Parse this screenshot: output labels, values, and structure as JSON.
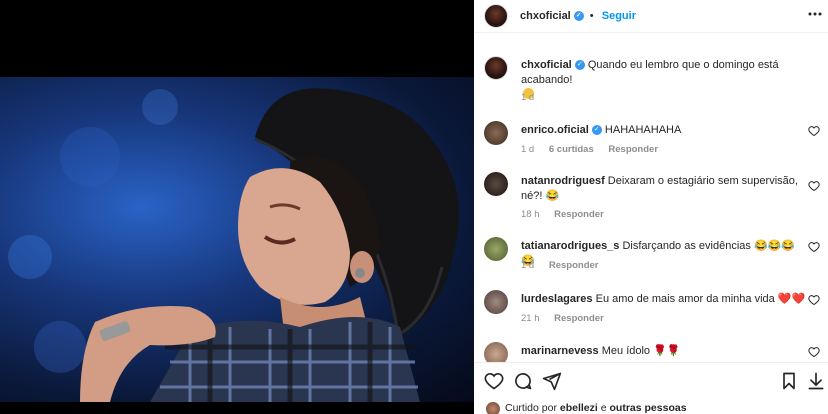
{
  "post": {
    "username": "chxoficial",
    "dot": "•",
    "follow_label": "Seguir",
    "more_label": "•••",
    "caption": "Quando eu lembro que o domingo está acabando!",
    "caption_age": "1 d"
  },
  "comments": [
    {
      "username": "enrico.oficial",
      "verified": true,
      "text": "HAHAHAHAHA",
      "age": "1 d",
      "likes": "6 curtidas",
      "reply": "Responder"
    },
    {
      "username": "natanrodriguesf",
      "verified": false,
      "text": "Deixaram o estagiário sem supervisão, né?! 😂",
      "age": "18 h",
      "likes": "",
      "reply": "Responder"
    },
    {
      "username": "tatianarodrigues_s",
      "verified": false,
      "text": "Disfarçando as evidências 😂😂😂😂",
      "age": "1 d",
      "likes": "",
      "reply": "Responder"
    },
    {
      "username": "lurdeslagares",
      "verified": false,
      "text": "Eu amo de mais amor da minha vida ❤️❤️",
      "age": "21 h",
      "likes": "",
      "reply": "Responder"
    },
    {
      "username": "marinarnevess",
      "verified": false,
      "text": "Meu ídolo 🌹🌹",
      "age": "",
      "likes": "",
      "reply": ""
    }
  ],
  "liked_by": {
    "prefix": "Curtido por",
    "user": "ebellezi",
    "connector": "e",
    "others": "outras pessoas"
  },
  "colors": {
    "accent": "#0095f6",
    "verified": "#3897f0"
  },
  "icons": [
    "heart-icon",
    "comment-icon",
    "share-icon",
    "bookmark-icon",
    "download-icon",
    "more-icon",
    "verified-icon"
  ]
}
